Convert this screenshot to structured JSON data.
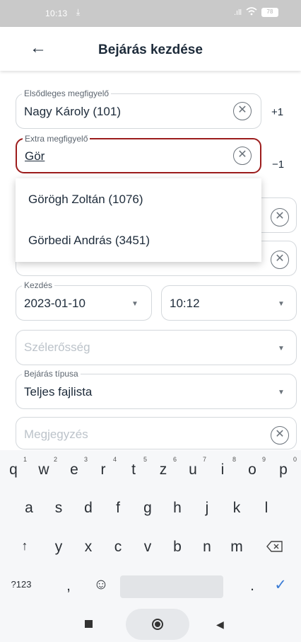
{
  "status": {
    "time": "10:13",
    "signal": ".ıll",
    "battery": "78"
  },
  "header": {
    "title": "Bejárás kezdése"
  },
  "form": {
    "primary_observer": {
      "label": "Elsődleges megfigyelő",
      "value": "Nagy Károly (101)",
      "side_action": "+1"
    },
    "extra_observer": {
      "label": "Extra megfigyelő",
      "value": "Gör",
      "side_action": "−1"
    },
    "start": {
      "label": "Kezdés",
      "date": "2023-01-10",
      "time": "10:12"
    },
    "wind": {
      "placeholder": "Szélerősség"
    },
    "type": {
      "label": "Bejárás típusa",
      "value": "Teljes fajlista"
    },
    "note": {
      "placeholder": "Megjegyzés"
    }
  },
  "suggestions": [
    "Görögh Zoltán (1076)",
    "Görbedi András (3451)"
  ],
  "accent_color": "#9c1c1c",
  "keyboard": {
    "row1": [
      "q",
      "w",
      "e",
      "r",
      "t",
      "z",
      "u",
      "i",
      "o",
      "p"
    ],
    "row1_digits": [
      "1",
      "2",
      "3",
      "4",
      "5",
      "6",
      "7",
      "8",
      "9",
      "0"
    ],
    "row2": [
      "a",
      "s",
      "d",
      "f",
      "g",
      "h",
      "j",
      "k",
      "l"
    ],
    "row3": [
      "y",
      "x",
      "c",
      "v",
      "b",
      "n",
      "m"
    ],
    "symbols_key": "?123",
    "comma_key": ",",
    "period_key": "."
  }
}
